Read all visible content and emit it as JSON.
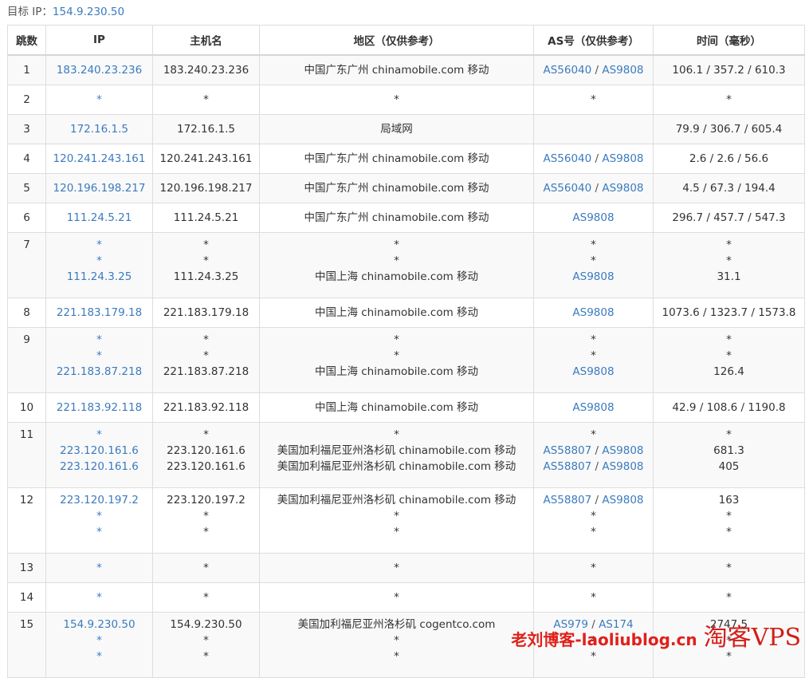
{
  "target": {
    "label": "目标 IP：",
    "ip": "154.9.230.50"
  },
  "columns": [
    "跳数",
    "IP",
    "主机名",
    "地区（仅供参考）",
    "AS号（仅供参考）",
    "时间（毫秒）"
  ],
  "hops": [
    {
      "hop": "1",
      "lines": [
        {
          "ip": "183.240.23.236",
          "host": "183.240.23.236",
          "region": "中国广东广州 chinamobile.com 移动",
          "as": [
            "AS56040",
            "AS9808"
          ],
          "time": "106.1 / 357.2 / 610.3"
        }
      ]
    },
    {
      "hop": "2",
      "lines": [
        {
          "ip": "*",
          "host": "*",
          "region": "*",
          "as": [
            "*"
          ],
          "time": "*"
        }
      ]
    },
    {
      "hop": "3",
      "lines": [
        {
          "ip": "172.16.1.5",
          "host": "172.16.1.5",
          "region": "局域网",
          "as": [],
          "time": "79.9 / 306.7 / 605.4"
        }
      ]
    },
    {
      "hop": "4",
      "lines": [
        {
          "ip": "120.241.243.161",
          "host": "120.241.243.161",
          "region": "中国广东广州 chinamobile.com 移动",
          "as": [
            "AS56040",
            "AS9808"
          ],
          "time": "2.6 / 2.6 / 56.6"
        }
      ]
    },
    {
      "hop": "5",
      "lines": [
        {
          "ip": "120.196.198.217",
          "host": "120.196.198.217",
          "region": "中国广东广州 chinamobile.com 移动",
          "as": [
            "AS56040",
            "AS9808"
          ],
          "time": "4.5 / 67.3 / 194.4"
        }
      ]
    },
    {
      "hop": "6",
      "lines": [
        {
          "ip": "111.24.5.21",
          "host": "111.24.5.21",
          "region": "中国广东广州 chinamobile.com 移动",
          "as": [
            "AS9808"
          ],
          "time": "296.7 / 457.7 / 547.3"
        }
      ]
    },
    {
      "hop": "7",
      "lines": [
        {
          "ip": "*",
          "host": "*",
          "region": "*",
          "as": [
            "*"
          ],
          "time": "*"
        },
        {
          "ip": "*",
          "host": "*",
          "region": "*",
          "as": [
            "*"
          ],
          "time": "*"
        },
        {
          "ip": "111.24.3.25",
          "host": "111.24.3.25",
          "region": "中国上海 chinamobile.com 移动",
          "as": [
            "AS9808"
          ],
          "time": "31.1"
        }
      ]
    },
    {
      "hop": "8",
      "lines": [
        {
          "ip": "221.183.179.18",
          "host": "221.183.179.18",
          "region": "中国上海 chinamobile.com 移动",
          "as": [
            "AS9808"
          ],
          "time": "1073.6 / 1323.7 / 1573.8"
        }
      ]
    },
    {
      "hop": "9",
      "lines": [
        {
          "ip": "*",
          "host": "*",
          "region": "*",
          "as": [
            "*"
          ],
          "time": "*"
        },
        {
          "ip": "*",
          "host": "*",
          "region": "*",
          "as": [
            "*"
          ],
          "time": "*"
        },
        {
          "ip": "221.183.87.218",
          "host": "221.183.87.218",
          "region": "中国上海 chinamobile.com 移动",
          "as": [
            "AS9808"
          ],
          "time": "126.4"
        }
      ]
    },
    {
      "hop": "10",
      "lines": [
        {
          "ip": "221.183.92.118",
          "host": "221.183.92.118",
          "region": "中国上海 chinamobile.com 移动",
          "as": [
            "AS9808"
          ],
          "time": "42.9 / 108.6 / 1190.8"
        }
      ]
    },
    {
      "hop": "11",
      "lines": [
        {
          "ip": "*",
          "host": "*",
          "region": "*",
          "as": [
            "*"
          ],
          "time": "*"
        },
        {
          "ip": "223.120.161.6",
          "host": "223.120.161.6",
          "region": "美国加利福尼亚州洛杉矶 chinamobile.com 移动",
          "as": [
            "AS58807",
            "AS9808"
          ],
          "time": "681.3"
        },
        {
          "ip": "223.120.161.6",
          "host": "223.120.161.6",
          "region": "美国加利福尼亚州洛杉矶 chinamobile.com 移动",
          "as": [
            "AS58807",
            "AS9808"
          ],
          "time": "405"
        }
      ]
    },
    {
      "hop": "12",
      "lines": [
        {
          "ip": "223.120.197.2",
          "host": "223.120.197.2",
          "region": "美国加利福尼亚州洛杉矶 chinamobile.com 移动",
          "as": [
            "AS58807",
            "AS9808"
          ],
          "time": "163"
        },
        {
          "ip": "*",
          "host": "*",
          "region": "*",
          "as": [
            "*"
          ],
          "time": "*"
        },
        {
          "ip": "*",
          "host": "*",
          "region": "*",
          "as": [
            "*"
          ],
          "time": "*"
        }
      ]
    },
    {
      "hop": "13",
      "lines": [
        {
          "ip": "*",
          "host": "*",
          "region": "*",
          "as": [
            "*"
          ],
          "time": "*"
        }
      ]
    },
    {
      "hop": "14",
      "lines": [
        {
          "ip": "*",
          "host": "*",
          "region": "*",
          "as": [
            "*"
          ],
          "time": "*"
        }
      ]
    },
    {
      "hop": "15",
      "lines": [
        {
          "ip": "154.9.230.50",
          "host": "154.9.230.50",
          "region": "美国加利福尼亚州洛杉矶 cogentco.com",
          "as": [
            "AS979",
            "AS174"
          ],
          "time": "2747.5"
        },
        {
          "ip": "*",
          "host": "*",
          "region": "*",
          "as": [
            "*"
          ],
          "time": "*"
        },
        {
          "ip": "*",
          "host": "*",
          "region": "*",
          "as": [
            "*"
          ],
          "time": "*"
        }
      ]
    }
  ],
  "watermark": {
    "cn": "老刘博客-laoliublog.cn",
    "logo": "淘客VPS"
  },
  "colors": {
    "link": "#3b7bbf",
    "border": "#dddddd",
    "zebra": "#f9f9f9",
    "watermark": "#e0201a"
  }
}
